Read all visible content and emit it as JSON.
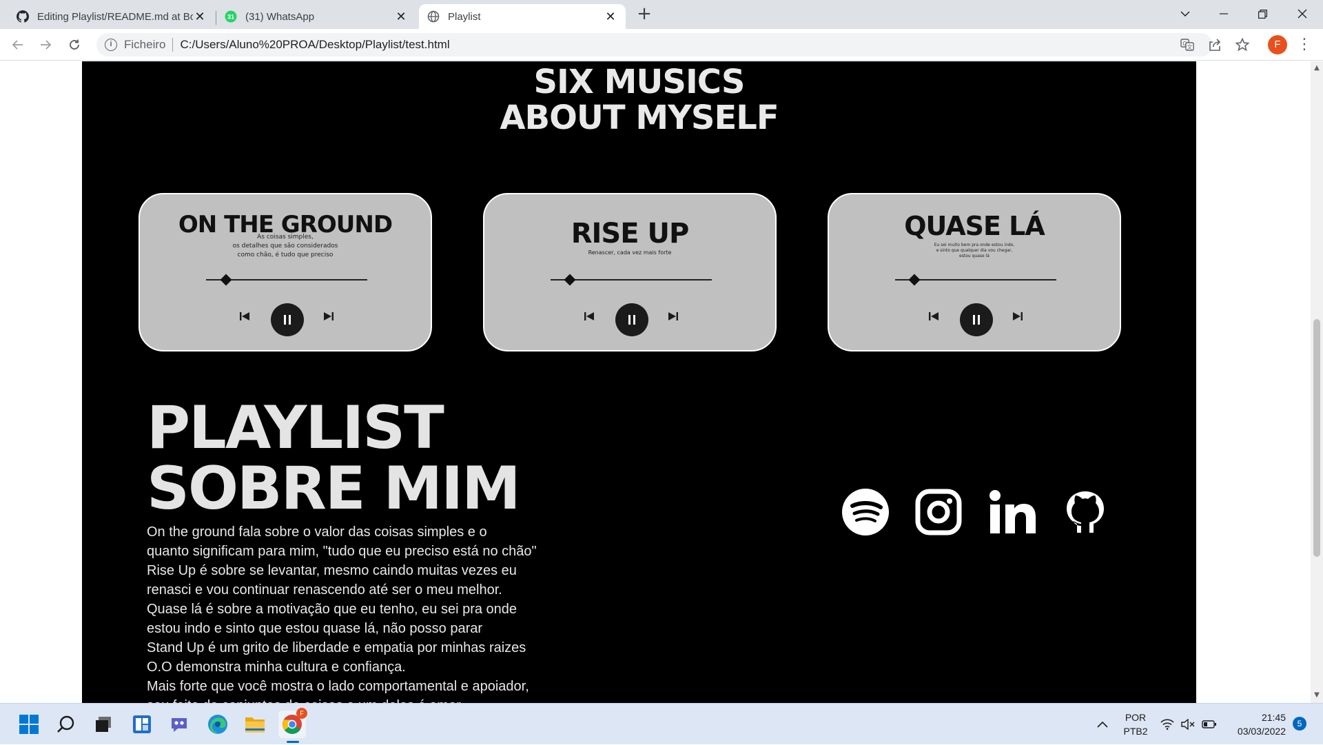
{
  "browser": {
    "tabs": [
      {
        "title": "Editing Playlist/README.md at Bo",
        "icon": "github-icon",
        "active": false
      },
      {
        "title": "(31) WhatsApp",
        "icon": "whatsapp-icon",
        "badge": "31",
        "active": false
      },
      {
        "title": "Playlist",
        "icon": "globe-icon",
        "active": true
      }
    ],
    "address": {
      "scheme": "Ficheiro",
      "url": "C:/Users/Aluno%20PROA/Desktop/Playlist/test.html"
    },
    "profile_initial": "F",
    "close_glyph": "✕",
    "newtab_glyph": "+"
  },
  "page": {
    "heading": "SIX MUSICS\nABOUT MYSELF",
    "cards": [
      {
        "title": "ON THE GROUND",
        "description": "As coisas simples,\nos detalhes que são considerados\ncomo chão, é tudo que preciso"
      },
      {
        "title": "RISE UP",
        "description": "Renascer, cada vez mais forte"
      },
      {
        "title": "QUASE LÁ",
        "description": "Eu sei muito bem pra onde estou indo,\ne sinto que qualquer dia vou chegar,\nestou quase lá"
      }
    ],
    "big_title": "PLAYLIST\nSOBRE MIM",
    "paragraph": " On the ground fala sobre o valor das coisas simples e o\nquanto significam para mim, \"tudo que eu preciso está no chão\"\nRise Up é sobre se levantar, mesmo caindo muitas vezes eu\nrenasci e vou continuar renascendo até ser o meu melhor.\nQuase lá é sobre a motivação que eu tenho, eu sei pra onde\nestou indo e sinto que estou quase lá, não posso parar\nStand Up é um grito de liberdade e empatia por minhas raizes\nO.O demonstra minha cultura e confiança.\nMais forte que você  mostra o lado comportamental e apoiador,\nsou feito de conjuntos de coisas e um deles é amor",
    "social_icons": [
      "spotify-icon",
      "instagram-icon",
      "linkedin-icon",
      "github-icon"
    ]
  },
  "taskbar": {
    "language": "POR",
    "layout": "PTB2",
    "time": "21:45",
    "date": "03/03/2022",
    "notifications": "5",
    "chrome_badge": "F"
  },
  "colors": {
    "page_background": "#000000",
    "card_background": "#c0c0c0",
    "heading_text": "#e9e9e9",
    "profile_accent": "#e8501e",
    "taskbar": "#dde6f4"
  }
}
